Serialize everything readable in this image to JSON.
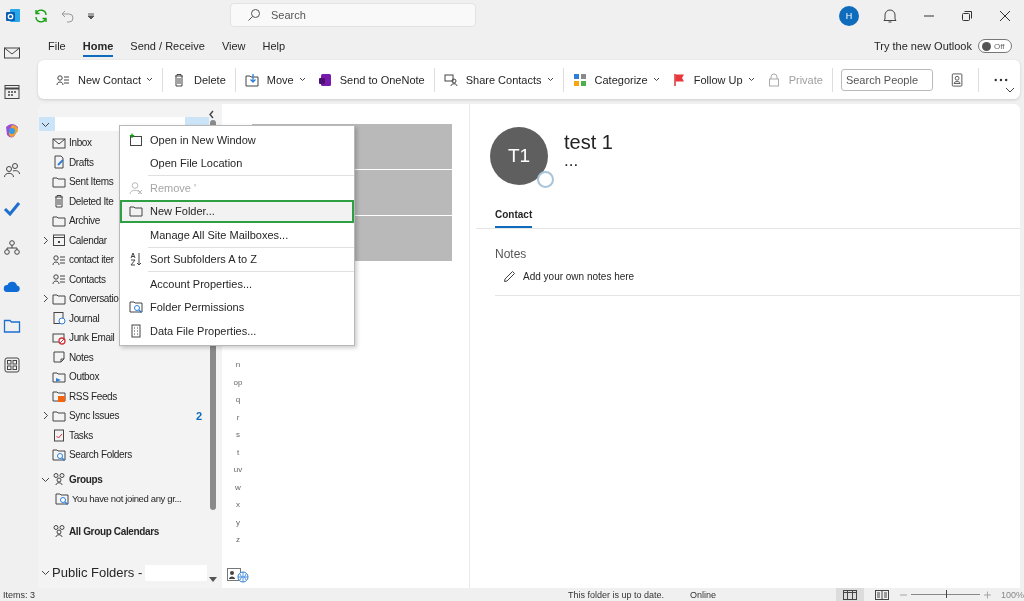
{
  "title_bar": {
    "search_placeholder": "Search",
    "account_initial": "H"
  },
  "menu_tabs": [
    {
      "label": "File",
      "selected": false
    },
    {
      "label": "Home",
      "selected": true
    },
    {
      "label": "Send / Receive",
      "selected": false
    },
    {
      "label": "View",
      "selected": false
    },
    {
      "label": "Help",
      "selected": false
    }
  ],
  "new_outlook": {
    "label": "Try the new Outlook",
    "on": false,
    "state_text": "Off"
  },
  "ribbon": {
    "groups": [
      [
        {
          "label": "New Contact",
          "dropdown": true,
          "disabled": false
        }
      ],
      [
        {
          "label": "Delete",
          "dropdown": false,
          "disabled": false
        }
      ],
      [
        {
          "label": "Move",
          "dropdown": true,
          "disabled": false
        },
        {
          "label": "Send to OneNote",
          "dropdown": false,
          "disabled": false
        }
      ],
      [
        {
          "label": "Share Contacts",
          "dropdown": true,
          "disabled": false
        }
      ],
      [
        {
          "label": "Categorize",
          "dropdown": true,
          "disabled": false
        },
        {
          "label": "Follow Up",
          "dropdown": true,
          "disabled": false
        },
        {
          "label": "Private",
          "dropdown": false,
          "disabled": true
        }
      ]
    ],
    "search_placeholder": "Search People"
  },
  "folder_pane": {
    "account": {
      "expanded": true,
      "selected": true
    },
    "folders": [
      {
        "label": "Inbox"
      },
      {
        "label": "Drafts"
      },
      {
        "label": "Sent Items"
      },
      {
        "label": "Deleted Ite"
      },
      {
        "label": "Archive"
      },
      {
        "label": "Calendar",
        "expanded": false
      },
      {
        "label": "contact iter"
      },
      {
        "label": "Contacts"
      },
      {
        "label": "Conversatio",
        "expanded": false
      },
      {
        "label": "Journal"
      },
      {
        "label": "Junk Email"
      },
      {
        "label": "Notes"
      },
      {
        "label": "Outbox"
      },
      {
        "label": "RSS Feeds"
      },
      {
        "label": "Sync Issues",
        "expanded": false,
        "count": "2"
      },
      {
        "label": "Tasks"
      },
      {
        "label": "Search Folders"
      }
    ],
    "groups": {
      "label": "Groups",
      "expanded": true,
      "children": [
        {
          "label": "You have not joined any gr..."
        }
      ]
    },
    "all_group_calendars": "All Group Calendars",
    "public_folders": {
      "label": "Public Folders -",
      "expanded": true
    }
  },
  "context_menu": [
    {
      "label": "Open in New Window",
      "disabled": false,
      "selected": false
    },
    {
      "label": "Open File Location",
      "disabled": false,
      "selected": false
    },
    {
      "label": "Remove '",
      "disabled": true,
      "selected": false
    },
    {
      "label": "New Folder...",
      "disabled": false,
      "selected": true
    },
    {
      "label": "Manage All Site Mailboxes...",
      "disabled": false,
      "selected": false
    },
    {
      "label": "Sort Subfolders A to Z",
      "disabled": false,
      "selected": false
    },
    {
      "label": "Account Properties...",
      "disabled": false,
      "selected": false
    },
    {
      "label": "Folder Permissions",
      "disabled": false,
      "selected": false
    },
    {
      "label": "Data File Properties...",
      "disabled": false,
      "selected": false
    }
  ],
  "index_letters": [
    "n",
    "op",
    "q",
    "r",
    "s",
    "t",
    "uv",
    "w",
    "x",
    "y",
    "z"
  ],
  "contact": {
    "initials": "T1",
    "name": "test 1",
    "subtitle": "...",
    "tabs": [
      {
        "label": "Contact",
        "selected": true
      }
    ],
    "notes_heading": "Notes",
    "notes_prompt": "Add your own notes here"
  },
  "status_bar": {
    "items": "Items: 3",
    "sync": "This folder is up to date.",
    "connection": "Online",
    "views": [
      {
        "selected": true
      },
      {
        "selected": false
      }
    ],
    "zoom": {
      "level": 0.5,
      "label": "100%"
    }
  }
}
